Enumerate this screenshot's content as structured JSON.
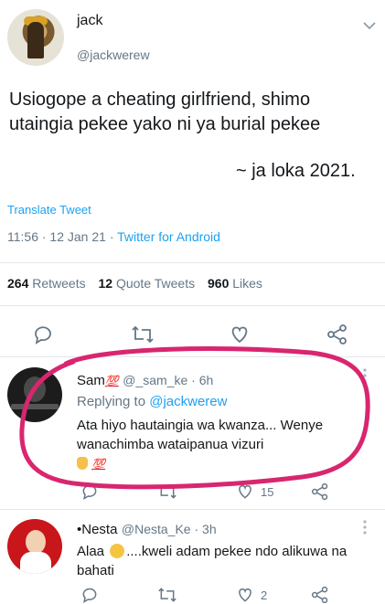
{
  "tweet": {
    "name": "jack",
    "handle": "@jackwerew",
    "text": "Usiogope a cheating girlfriend, shimo utaingia pekee yako ni ya burial pekee",
    "signature": "~ ja loka 2021.",
    "translate_label": "Translate Tweet",
    "time": "11:56 · 12 Jan 21 ·",
    "source": "Twitter for Android",
    "retweets_count": "264",
    "retweets_label": "Retweets",
    "quotes_count": "12",
    "quotes_label": "Quote Tweets",
    "likes_count": "960",
    "likes_label": "Likes"
  },
  "replies": [
    {
      "name": "Sam",
      "name_emoji": "💯",
      "handle": "@_sam_ke · 6h",
      "replying_prefix": "Replying to",
      "replying_to": "@jackwerew",
      "text_line1": "Ata hiyo hautaingia wa kwanza... Wenye",
      "text_line2": "wanachimba wataipanua vizuri",
      "emoji_line": "💯",
      "like_count": "15"
    },
    {
      "name": "•Nesta",
      "handle": "@Nesta_Ke · 3h",
      "text_prefix": "Alaa",
      "text_line1": "....kweli adam pekee ndo alikuwa na",
      "text_line2": "bahati",
      "like_count": "2"
    }
  ],
  "colors": {
    "accent": "#1da1f2",
    "muted": "#657786",
    "annotation": "#d8266f"
  },
  "icons": [
    "chevron-down-icon",
    "reply-icon",
    "retweet-icon",
    "like-icon",
    "share-icon",
    "more-vertical-icon"
  ]
}
